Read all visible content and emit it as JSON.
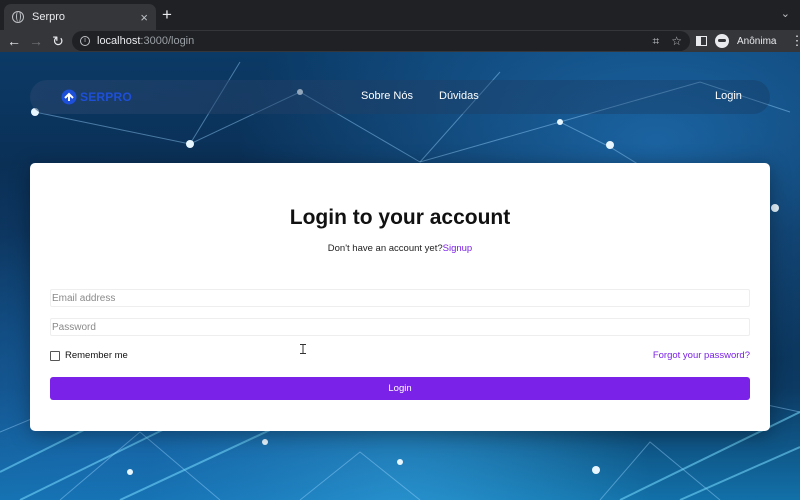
{
  "browser": {
    "tab_title": "Serpro",
    "tab_close": "×",
    "new_tab": "+",
    "tab_menu": "⌄",
    "back": "←",
    "forward": "→",
    "reload": "↻",
    "url_host": "localhost",
    "url_path": ":3000/login",
    "incognito_label": "Anônima",
    "menu": "⋮"
  },
  "navbar": {
    "brand": "SERPRO",
    "links": [
      "Sobre Nós",
      "Dúvidas"
    ],
    "login": "Login"
  },
  "form": {
    "title": "Login to your account",
    "signup_prompt": "Don't have an account yet?",
    "signup_link": "Signup",
    "email_placeholder": "Email address",
    "password_placeholder": "Password",
    "remember_label": "Remember me",
    "forgot_label": "Forgot your password?",
    "submit_label": "Login",
    "accent_color": "#7a22e8"
  },
  "colors": {
    "brand_blue": "#1e4fd8",
    "link_purple": "#7a1fe6"
  }
}
